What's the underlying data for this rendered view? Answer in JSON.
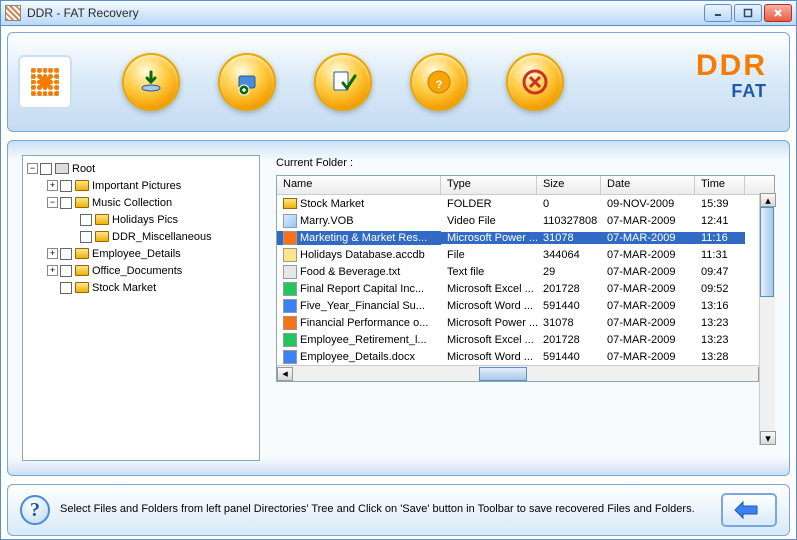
{
  "window": {
    "title": "DDR - FAT Recovery"
  },
  "brand": {
    "ddr": "DDR",
    "fat": "FAT"
  },
  "tree": {
    "root": "Root",
    "items": [
      {
        "label": "Important Pictures",
        "indent": 1,
        "exp": "+"
      },
      {
        "label": "Music Collection",
        "indent": 1,
        "exp": "−"
      },
      {
        "label": "Holidays Pics",
        "indent": 2,
        "exp": ""
      },
      {
        "label": "DDR_Miscellaneous",
        "indent": 2,
        "exp": ""
      },
      {
        "label": "Employee_Details",
        "indent": 1,
        "exp": "+"
      },
      {
        "label": "Office_Documents",
        "indent": 1,
        "exp": "+"
      },
      {
        "label": "Stock Market",
        "indent": 1,
        "exp": ""
      }
    ]
  },
  "right": {
    "current_folder_label": "Current Folder  :"
  },
  "columns": {
    "name": "Name",
    "type": "Type",
    "size": "Size",
    "date": "Date",
    "time": "Time"
  },
  "files": [
    {
      "name": "Stock Market",
      "type": "FOLDER",
      "size": "0",
      "date": "09-NOV-2009",
      "time": "15:39",
      "icon": "folder"
    },
    {
      "name": "Marry.VOB",
      "type": "Video File",
      "size": "110327808",
      "date": "07-MAR-2009",
      "time": "12:41",
      "icon": "video"
    },
    {
      "name": "Marketing & Market Res...",
      "type": "Microsoft Power ...",
      "size": "31078",
      "date": "07-MAR-2009",
      "time": "11:16",
      "icon": "ppt",
      "selected": true
    },
    {
      "name": "Holidays Database.accdb",
      "type": "File",
      "size": "344064",
      "date": "07-MAR-2009",
      "time": "11:31",
      "icon": "db"
    },
    {
      "name": "Food & Beverage.txt",
      "type": "Text file",
      "size": "29",
      "date": "07-MAR-2009",
      "time": "09:47",
      "icon": "txt"
    },
    {
      "name": "Final Report Capital Inc...",
      "type": "Microsoft Excel ...",
      "size": "201728",
      "date": "07-MAR-2009",
      "time": "09:52",
      "icon": "xls"
    },
    {
      "name": "Five_Year_Financial Su...",
      "type": "Microsoft Word ...",
      "size": "591440",
      "date": "07-MAR-2009",
      "time": "13:16",
      "icon": "doc"
    },
    {
      "name": "Financial Performance o...",
      "type": "Microsoft Power ...",
      "size": "31078",
      "date": "07-MAR-2009",
      "time": "13:23",
      "icon": "ppt"
    },
    {
      "name": "Employee_Retirement_l...",
      "type": "Microsoft Excel ...",
      "size": "201728",
      "date": "07-MAR-2009",
      "time": "13:23",
      "icon": "xls"
    },
    {
      "name": "Employee_Details.docx",
      "type": "Microsoft Word ...",
      "size": "591440",
      "date": "07-MAR-2009",
      "time": "13:28",
      "icon": "doc"
    }
  ],
  "footer": {
    "text": "Select Files and Folders from left panel Directories' Tree and Click on 'Save' button in Toolbar to save recovered Files and Folders."
  }
}
